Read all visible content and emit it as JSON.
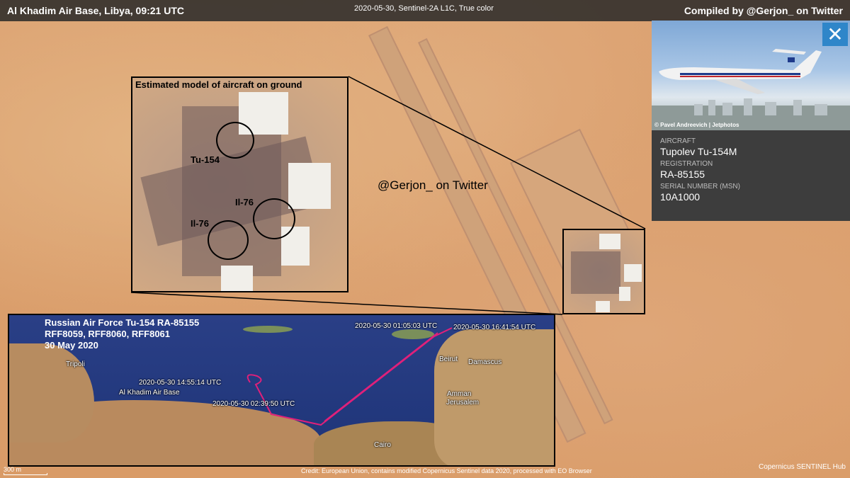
{
  "header": {
    "location": "Al Khadim Air Base, Libya, 09:21 UTC",
    "imagery": "2020-05-30, Sentinel-2A L1C, True color",
    "compiled_by": "Compiled by @Gerjon_ on Twitter"
  },
  "zoom_inset": {
    "title": "Estimated model of aircraft on ground",
    "labels": [
      "Tu-154",
      "Il-76",
      "Il-76"
    ]
  },
  "watermark": "@Gerjon_ on Twitter",
  "info_panel": {
    "photo_credit": "© Pavel Andreevich | Jetphotos",
    "close_glyph": "✕",
    "fields": [
      {
        "label": "AIRCRAFT",
        "value": "Tupolev Tu-154M"
      },
      {
        "label": "REGISTRATION",
        "value": "RA-85155"
      },
      {
        "label": "SERIAL NUMBER (MSN)",
        "value": "10A1000"
      }
    ]
  },
  "map_inset": {
    "title_lines": [
      "Russian Air Force Tu-154 RA-85155",
      "RFF8059, RFF8060, RFF8061",
      "30 May 2020"
    ],
    "places": [
      "Tripoli",
      "Al Khadim Air Base",
      "Cairo",
      "Beirut",
      "Damascus",
      "Amman",
      "Jerusalem"
    ],
    "times": [
      "2020-05-30 01:05:03 UTC",
      "2020-05-30 16:41:54 UTC",
      "2020-05-30 14:55:14 UTC",
      "2020-05-30 02:39:50 UTC"
    ],
    "track_color": "#e0207a"
  },
  "footer": {
    "scale": "300 m",
    "credit": "Credit: European Union, contains modified Copernicus Sentinel data 2020, processed with EO Browser",
    "logos": "Copernicus  SENTINEL Hub"
  }
}
